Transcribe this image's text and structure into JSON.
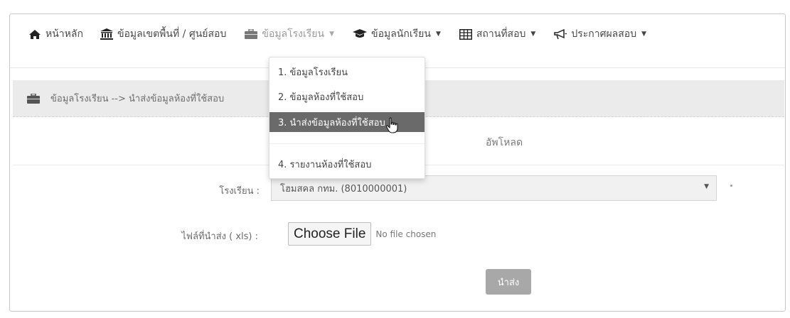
{
  "navbar": {
    "items": [
      {
        "label": "หน้าหลัก",
        "icon": "home-icon",
        "has_caret": false
      },
      {
        "label": "ข้อมูลเขตพื้นที่ / ศูนย์สอบ",
        "icon": "institution-icon",
        "has_caret": false
      },
      {
        "label": "ข้อมูลโรงเรียน",
        "icon": "briefcase-icon",
        "has_caret": true
      },
      {
        "label": "ข้อมูลนักเรียน",
        "icon": "graduation-cap-icon",
        "has_caret": true
      },
      {
        "label": "สถานที่สอบ",
        "icon": "table-icon",
        "has_caret": true
      },
      {
        "label": "ประกาศผลสอบ",
        "icon": "bullhorn-icon",
        "has_caret": true
      }
    ]
  },
  "dropdown": {
    "items": [
      "1. ข้อมูลโรงเรียน",
      "2. ข้อมูลห้องที่ใช้สอบ",
      "3. นำส่งข้อมูลห้องที่ใช้สอบ",
      "4. รายงานห้องที่ใช้สอบ"
    ],
    "highlighted": "3. นำส่งข้อมูลห้องที่ใช้สอบ"
  },
  "breadcrumb": {
    "text": "ข้อมูลโรงเรียน --> นำส่งข้อมูลห้องที่ใช้สอบ"
  },
  "panel": {
    "title": "อัพโหลด"
  },
  "form": {
    "school_label": "โรงเรียน :",
    "school_value": "โฮมสคล กทม. (8010000001)",
    "file_label": "ไฟล์ที่นำส่ง ( xls) :",
    "file_button": "Choose File",
    "file_status": "No file chosen",
    "submit_label": "นำส่ง"
  },
  "colors": {
    "highlight": "#6a6a6a",
    "breadcrumb_bg": "#ebebeb",
    "submit_bg": "#a8a8a8"
  }
}
